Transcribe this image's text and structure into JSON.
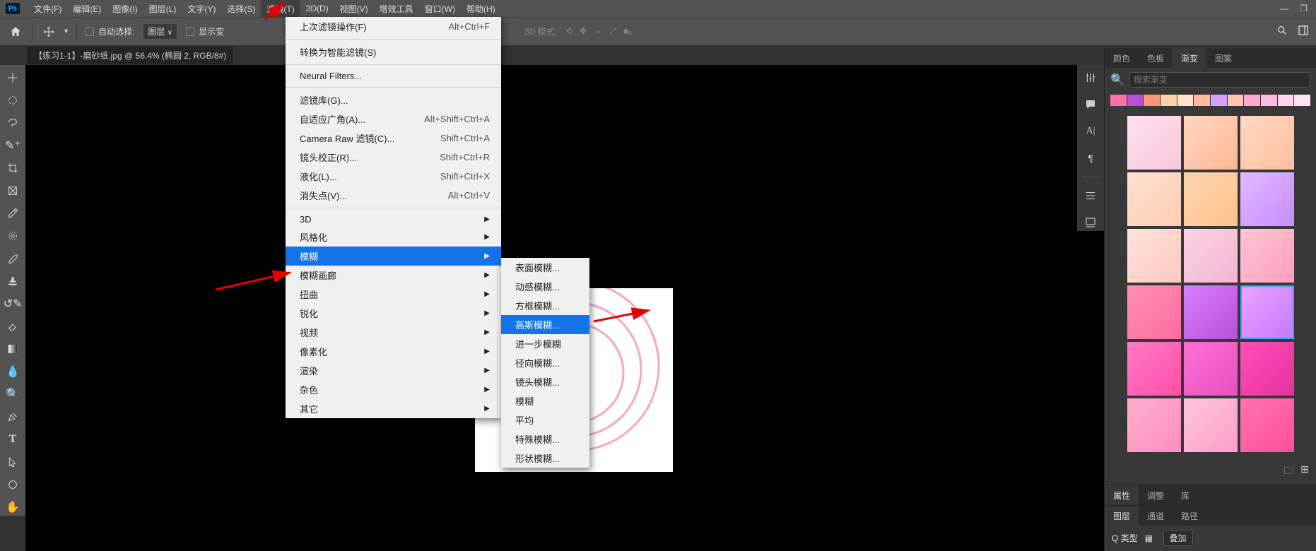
{
  "menubar": {
    "items": [
      "文件(F)",
      "编辑(E)",
      "图像(I)",
      "图层(L)",
      "文字(Y)",
      "选择(S)",
      "滤镜(T)",
      "3D(D)",
      "视图(V)",
      "增效工具",
      "窗口(W)",
      "帮助(H)"
    ]
  },
  "optionsbar": {
    "auto_select_label": "自动选择:",
    "layer_dropdown": "图层",
    "show_label": "显示变",
    "mode_label": "3D 模式:"
  },
  "document_tab": "【练习1-1】-磨砂纸.jpg @ 56.4% (椭圆 2, RGB/8#)",
  "filter_menu": {
    "items": [
      {
        "label": "上次滤镜操作(F)",
        "shortcut": "Alt+Ctrl+F"
      },
      {
        "sep": true
      },
      {
        "label": "转换为智能滤镜(S)"
      },
      {
        "sep": true
      },
      {
        "label": "Neural Filters..."
      },
      {
        "sep": true
      },
      {
        "label": "滤镜库(G)..."
      },
      {
        "label": "自适应广角(A)...",
        "shortcut": "Alt+Shift+Ctrl+A"
      },
      {
        "label": "Camera Raw 滤镜(C)...",
        "shortcut": "Shift+Ctrl+A"
      },
      {
        "label": "镜头校正(R)...",
        "shortcut": "Shift+Ctrl+R"
      },
      {
        "label": "液化(L)...",
        "shortcut": "Shift+Ctrl+X"
      },
      {
        "label": "消失点(V)...",
        "shortcut": "Alt+Ctrl+V"
      },
      {
        "sep": true
      },
      {
        "label": "3D",
        "sub": true
      },
      {
        "label": "风格化",
        "sub": true
      },
      {
        "label": "模糊",
        "sub": true,
        "highlight": true
      },
      {
        "label": "模糊画廊",
        "sub": true
      },
      {
        "label": "扭曲",
        "sub": true
      },
      {
        "label": "锐化",
        "sub": true
      },
      {
        "label": "视频",
        "sub": true
      },
      {
        "label": "像素化",
        "sub": true
      },
      {
        "label": "渲染",
        "sub": true
      },
      {
        "label": "杂色",
        "sub": true
      },
      {
        "label": "其它",
        "sub": true
      }
    ]
  },
  "blur_submenu": {
    "items": [
      {
        "label": "表面模糊..."
      },
      {
        "label": "动感模糊..."
      },
      {
        "label": "方框模糊..."
      },
      {
        "label": "高斯模糊...",
        "highlight": true
      },
      {
        "label": "进一步模糊"
      },
      {
        "label": "径向模糊..."
      },
      {
        "label": "镜头模糊..."
      },
      {
        "label": "模糊"
      },
      {
        "label": "平均"
      },
      {
        "label": "特殊模糊..."
      },
      {
        "label": "形状模糊..."
      }
    ]
  },
  "right_tabs_1": [
    "颜色",
    "色板",
    "渐变",
    "图案"
  ],
  "search_placeholder": "搜索渐变",
  "right_tabs_2": [
    "属性",
    "调整",
    "库"
  ],
  "right_tabs_3": [
    "图层",
    "通道",
    "路径"
  ],
  "layer_panel": {
    "kind": "Q 类型",
    "blend": "叠加"
  },
  "gradient_colors": {
    "strip": [
      "#ff6fa8",
      "#b84fd8",
      "#ff9478",
      "#ffd1a7",
      "#ffe2cf",
      "#ffb9a0",
      "#d49fff",
      "#ffc6b8",
      "#ffa7cf",
      "#ffb8e0",
      "#ffd4ec",
      "#ffe3f1"
    ],
    "swatches": [
      [
        "#fce1f0",
        "#fbc7dd"
      ],
      [
        "#ffd7c0",
        "#ffb895"
      ],
      [
        "#ffd9c2",
        "#ffbe9e"
      ],
      [
        "#ffe0cf",
        "#ffceb3"
      ],
      [
        "#ffd5ad",
        "#ffc28c"
      ],
      [
        "#e3b8ff",
        "#c68dff"
      ],
      [
        "#ffe3dc",
        "#ffc9bf"
      ],
      [
        "#f9d5e5",
        "#f4b3d2"
      ],
      [
        "#ffc5d5",
        "#ff9fbd"
      ],
      [
        "#ff8eb5",
        "#ff6d9e"
      ],
      [
        "#d77fff",
        "#b84fd8"
      ],
      [
        "#e9a4ff",
        "#c678ff"
      ],
      [
        "#ff7ac4",
        "#ff4fab"
      ],
      [
        "#ff6fd4",
        "#e84fc0"
      ],
      [
        "#ff4fb8",
        "#e6309e"
      ],
      [
        "#ffafd1",
        "#ff8cbf"
      ],
      [
        "#ffc6dd",
        "#ff9ec8"
      ],
      [
        "#ff73b0",
        "#ff4f98"
      ]
    ],
    "selected_index": 11
  }
}
